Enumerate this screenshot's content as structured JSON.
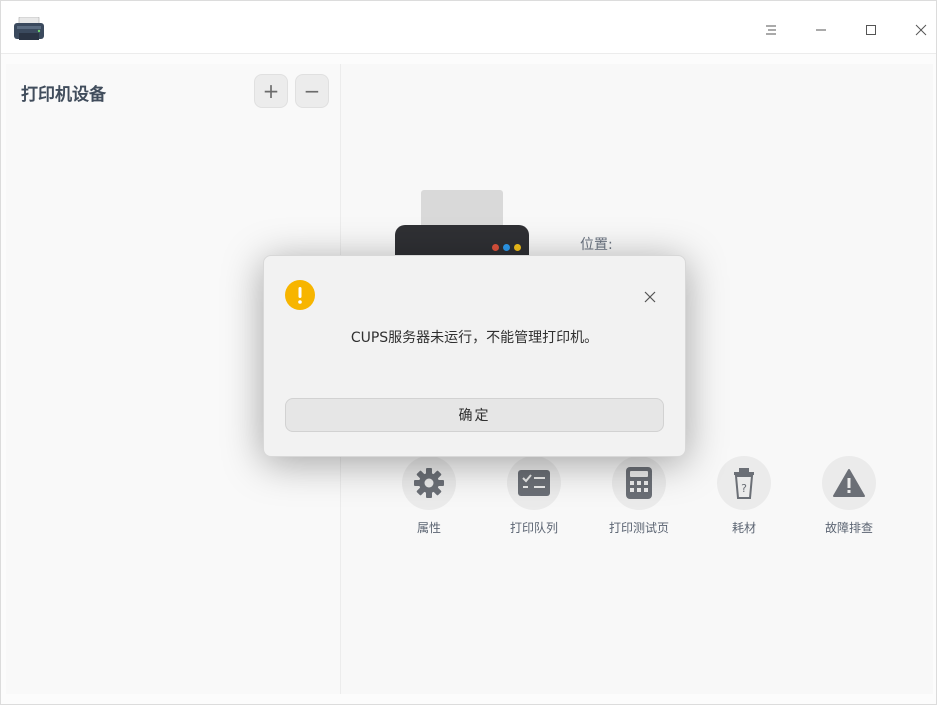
{
  "sidebar": {
    "title": "打印机设备",
    "add_label": "+",
    "remove_label": "−"
  },
  "details": {
    "location_label": "位置:"
  },
  "actions": [
    {
      "label": "属性",
      "icon": "gear-icon"
    },
    {
      "label": "打印队列",
      "icon": "print-queue-icon"
    },
    {
      "label": "打印测试页",
      "icon": "test-page-icon"
    },
    {
      "label": "耗材",
      "icon": "supplies-icon"
    },
    {
      "label": "故障排查",
      "icon": "warning-icon"
    }
  ],
  "dialog": {
    "message": "CUPS服务器未运行，不能管理打印机。",
    "ok_label": "确定",
    "warn_symbol": "!"
  },
  "colors": {
    "warning": "#f7b500",
    "icon_gray": "#6b6f76",
    "text_dark": "#303030"
  }
}
